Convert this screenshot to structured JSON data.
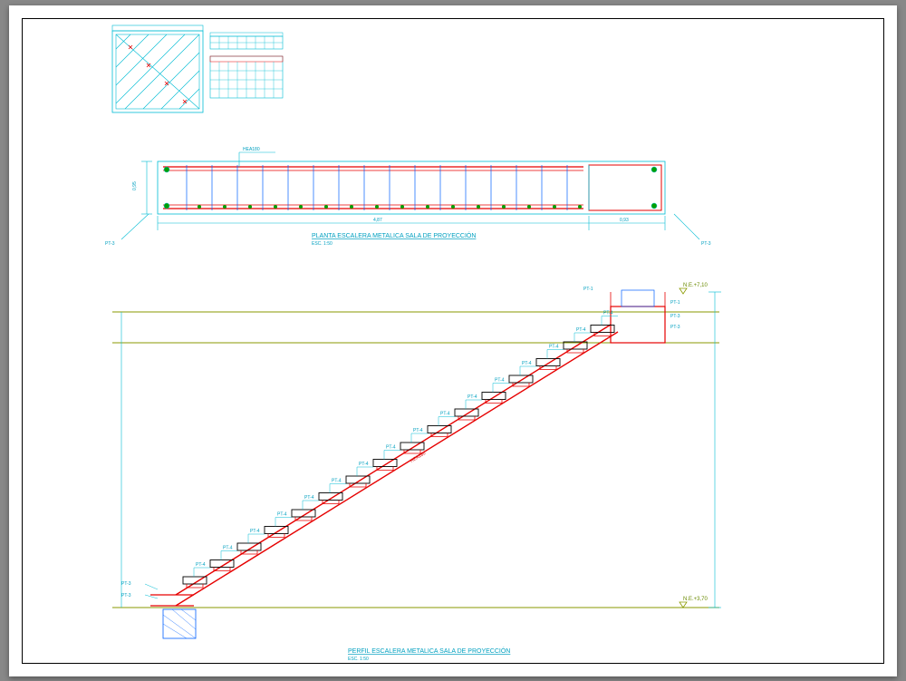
{
  "drawing": {
    "title_plan": "PLANTA ESCALERA METALICA SALA DE PROYECCIÓN",
    "title_profile": "PERFIL ESCALERA METALICA SALA DE PROYECCIÓN",
    "scale": "ESC. 1:50",
    "beam_label": "HEA180",
    "step_label": "PT-4",
    "support_label": "PT-3",
    "top_label": "PT-1",
    "level_top": "N.E.+7,10",
    "level_bottom": "N.E.+3,70",
    "plan_dim_total": "4,87",
    "plan_dim_height": "0,95",
    "plan_dim_landing": "0,93",
    "num_steps": 16
  },
  "colors": {
    "cyan": "#00bcd4",
    "red": "#e60000",
    "olive": "#8a9a00",
    "blue": "#0060ff",
    "green": "#00a000"
  }
}
